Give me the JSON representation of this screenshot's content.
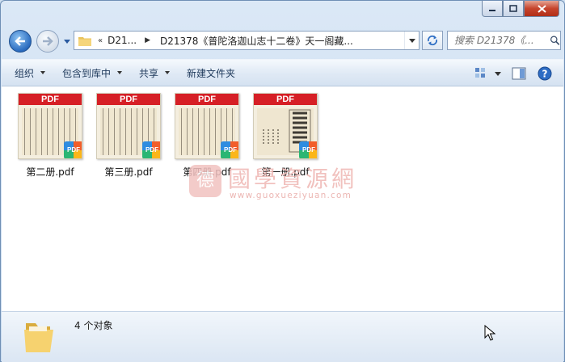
{
  "window": {
    "caption_buttons": [
      "minimize",
      "maximize",
      "close"
    ]
  },
  "address": {
    "chevrons": "«",
    "crumb1": "D21...",
    "crumb2": "D21378《普陀洛迦山志十二卷》天一阁藏...",
    "search_placeholder": "搜索 D21378《..."
  },
  "toolbar": {
    "organize": "组织",
    "include_library": "包含到库中",
    "share": "共享",
    "new_folder": "新建文件夹"
  },
  "files": [
    {
      "name": "第二册.pdf",
      "badge": "PDF",
      "band": "PDF"
    },
    {
      "name": "第三册.pdf",
      "badge": "PDF",
      "band": "PDF"
    },
    {
      "name": "第四册.pdf",
      "badge": "PDF",
      "band": "PDF"
    },
    {
      "name": "第一册.pdf",
      "badge": "PDF",
      "band": "PDF"
    }
  ],
  "watermark": {
    "logo_char": "德",
    "title": "國學資源網",
    "url": "www.guoxueziyuan.com"
  },
  "status": {
    "count_text": "4 个对象"
  },
  "colors": {
    "pdf_red": "#d61f26",
    "window_blue": "#cfe0f1",
    "watermark_pink": "#efb7b3"
  }
}
